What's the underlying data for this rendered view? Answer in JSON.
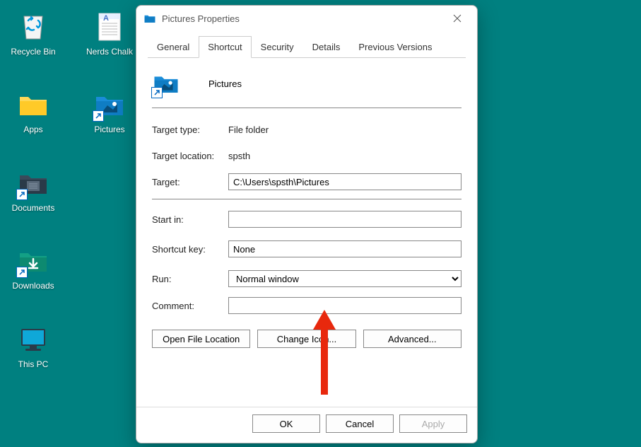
{
  "desktop": {
    "recycle": "Recycle Bin",
    "nerds": "Nerds Chalk",
    "apps": "Apps",
    "pictures": "Pictures",
    "documents": "Documents",
    "downloads": "Downloads",
    "thispc": "This PC"
  },
  "dialog": {
    "title": "Pictures Properties",
    "tabs": {
      "general": "General",
      "shortcut": "Shortcut",
      "security": "Security",
      "details": "Details",
      "previous": "Previous Versions"
    },
    "icon_name": "Pictures",
    "labels": {
      "target_type": "Target type:",
      "target_location": "Target location:",
      "target": "Target:",
      "start_in": "Start in:",
      "shortcut_key": "Shortcut key:",
      "run": "Run:",
      "comment": "Comment:"
    },
    "values": {
      "target_type": "File folder",
      "target_location": "spsth",
      "target": "C:\\Users\\spsth\\Pictures",
      "start_in": "",
      "shortcut_key": "None",
      "run": "Normal window",
      "comment": ""
    },
    "buttons": {
      "open_file_location": "Open File Location",
      "change_icon": "Change Icon...",
      "advanced": "Advanced...",
      "ok": "OK",
      "cancel": "Cancel",
      "apply": "Apply"
    }
  }
}
